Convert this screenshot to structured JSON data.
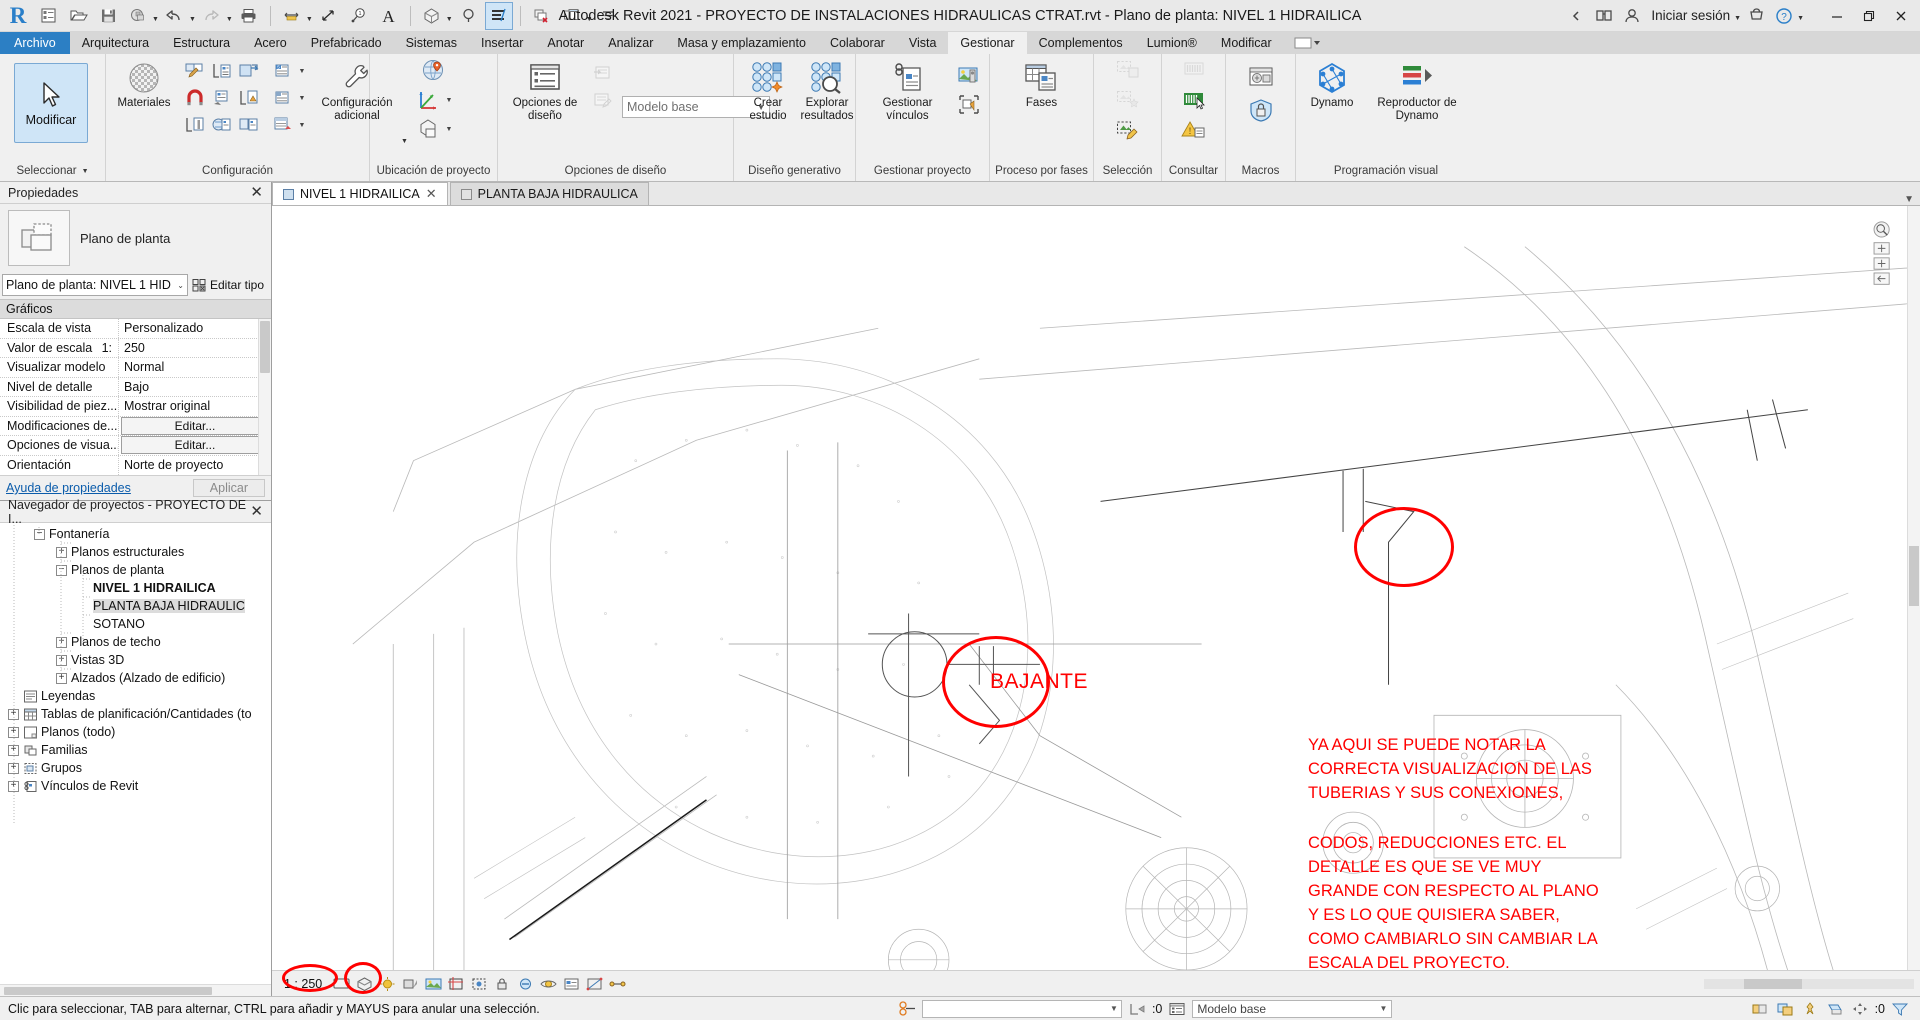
{
  "titlebar": {
    "title": "Autodesk Revit 2021 - PROYECTO DE INSTALACIONES HIDRAULICAS CTRAT.rvt - Plano de planta: NIVEL 1 HIDRAILICA",
    "sign_in": "Iniciar sesión",
    "qat": [
      {
        "name": "revit-logo",
        "label": "R"
      },
      {
        "name": "new-project-icon",
        "label": ""
      },
      {
        "name": "open-icon",
        "label": ""
      },
      {
        "name": "save-icon",
        "label": ""
      },
      {
        "name": "sync-with-central-icon",
        "label": ""
      },
      {
        "name": "undo-icon",
        "label": ""
      },
      {
        "name": "redo-icon",
        "label": ""
      },
      {
        "name": "print-icon",
        "label": ""
      },
      {
        "name": "measure-icon",
        "label": ""
      },
      {
        "name": "aligned-dimension-icon",
        "label": ""
      },
      {
        "name": "tag-icon",
        "label": ""
      },
      {
        "name": "text-icon",
        "label": "A"
      },
      {
        "name": "default-3d-view-icon",
        "label": ""
      },
      {
        "name": "section-icon",
        "label": ""
      },
      {
        "name": "thin-lines-icon",
        "label": ""
      },
      {
        "name": "close-hidden-windows-icon",
        "label": ""
      },
      {
        "name": "switch-windows-icon",
        "label": ""
      },
      {
        "name": "customize-qat-icon",
        "label": ""
      }
    ],
    "window_controls": [
      "minimize",
      "restore",
      "close"
    ]
  },
  "ribbon": {
    "tabs": [
      {
        "label": "Archivo",
        "state": "file"
      },
      {
        "label": "Arquitectura",
        "state": "normal"
      },
      {
        "label": "Estructura",
        "state": "normal"
      },
      {
        "label": "Acero",
        "state": "normal"
      },
      {
        "label": "Prefabricado",
        "state": "normal"
      },
      {
        "label": "Sistemas",
        "state": "normal"
      },
      {
        "label": "Insertar",
        "state": "normal"
      },
      {
        "label": "Anotar",
        "state": "normal"
      },
      {
        "label": "Analizar",
        "state": "normal"
      },
      {
        "label": "Masa y emplazamiento",
        "state": "normal"
      },
      {
        "label": "Colaborar",
        "state": "normal"
      },
      {
        "label": "Vista",
        "state": "normal"
      },
      {
        "label": "Gestionar",
        "state": "active"
      },
      {
        "label": "Complementos",
        "state": "normal"
      },
      {
        "label": "Lumion®",
        "state": "normal"
      },
      {
        "label": "Modificar",
        "state": "normal"
      }
    ],
    "panels": [
      {
        "label": "Seleccionar",
        "has_dropdown": true,
        "buttons": [
          {
            "name": "modify-button",
            "label": "Modificar",
            "selected": true
          }
        ]
      },
      {
        "label": "Configuración",
        "has_dropdown": false,
        "buttons": [
          {
            "name": "materials-button",
            "label": "Materiales"
          },
          {
            "name": "object-styles-button",
            "label": ""
          },
          {
            "name": "snaps-button",
            "label": ""
          },
          {
            "name": "project-information-button",
            "label": ""
          },
          {
            "name": "project-parameters-button",
            "label": ""
          },
          {
            "name": "shared-parameters-button",
            "label": ""
          },
          {
            "name": "transfer-project-standards-button",
            "label": ""
          },
          {
            "name": "purge-unused-button",
            "label": ""
          },
          {
            "name": "project-units-button",
            "label": ""
          },
          {
            "name": "structural-settings-button",
            "label": ""
          },
          {
            "name": "mep-settings-button",
            "label": ""
          },
          {
            "name": "panel-schedule-templates-button",
            "label": ""
          },
          {
            "name": "additional-settings-button",
            "label": "Configuración adicional"
          }
        ]
      },
      {
        "label": "Ubicación de proyecto",
        "has_dropdown": false,
        "buttons": [
          {
            "name": "location-button",
            "label": ""
          },
          {
            "name": "coordinates-button",
            "label": ""
          },
          {
            "name": "position-button",
            "label": ""
          }
        ]
      },
      {
        "label": "Opciones de diseño",
        "has_dropdown": false,
        "buttons": [
          {
            "name": "design-options-button",
            "label": "Opciones de diseño"
          },
          {
            "name": "pick-to-edit-button",
            "label": ""
          },
          {
            "name": "add-to-set-button",
            "label": ""
          }
        ],
        "combo": {
          "name": "design-option-combo",
          "value": "Modelo base"
        }
      },
      {
        "label": "Diseño generativo",
        "has_dropdown": false,
        "buttons": [
          {
            "name": "create-study-button",
            "label": "Crear estudio"
          },
          {
            "name": "explore-results-button",
            "label": "Explorar resultados"
          }
        ]
      },
      {
        "label": "Gestionar proyecto",
        "has_dropdown": false,
        "buttons": [
          {
            "name": "manage-links-button",
            "label": "Gestionar vínculos"
          },
          {
            "name": "manage-images-button",
            "label": ""
          },
          {
            "name": "starting-view-button",
            "label": ""
          }
        ]
      },
      {
        "label": "Proceso por fases",
        "has_dropdown": false,
        "buttons": [
          {
            "name": "phases-button",
            "label": "Fases"
          }
        ]
      },
      {
        "label": "Selección",
        "has_dropdown": false,
        "buttons": [
          {
            "name": "load-selection-button",
            "label": "",
            "disabled": true
          },
          {
            "name": "save-selection-button",
            "label": "",
            "disabled": true
          },
          {
            "name": "edit-selection-button",
            "label": ""
          }
        ]
      },
      {
        "label": "Consultar",
        "has_dropdown": false,
        "buttons": [
          {
            "name": "ids-of-selection-button",
            "label": "",
            "disabled": true
          },
          {
            "name": "select-by-id-button",
            "label": ""
          },
          {
            "name": "warnings-button",
            "label": ""
          }
        ]
      },
      {
        "label": "Macros",
        "has_dropdown": false,
        "buttons": [
          {
            "name": "macro-manager-button",
            "label": ""
          },
          {
            "name": "macro-security-button",
            "label": ""
          }
        ]
      },
      {
        "label": "Programación visual",
        "has_dropdown": false,
        "buttons": [
          {
            "name": "dynamo-button",
            "label": "Dynamo"
          },
          {
            "name": "dynamo-player-button",
            "label": "Reproductor de Dynamo"
          }
        ]
      }
    ]
  },
  "properties": {
    "title": "Propiedades",
    "type_name": "Plano de planta",
    "type_selector": "Plano de planta: NIVEL 1 HID",
    "edit_type": "Editar tipo",
    "group_graficos": "Gráficos",
    "rows": [
      {
        "key": "Escala de vista",
        "sub": "",
        "value": "Personalizado",
        "kind": "text"
      },
      {
        "key": "Valor de escala",
        "sub": "1:",
        "value": "250",
        "kind": "text"
      },
      {
        "key": "Visualizar modelo",
        "sub": "",
        "value": "Normal",
        "kind": "text"
      },
      {
        "key": "Nivel de detalle",
        "sub": "",
        "value": "Bajo",
        "kind": "text"
      },
      {
        "key": "Visibilidad de piez...",
        "sub": "",
        "value": "Mostrar original",
        "kind": "text"
      },
      {
        "key": "Modificaciones de...",
        "sub": "",
        "value": "Editar...",
        "kind": "button"
      },
      {
        "key": "Opciones de visua...",
        "sub": "",
        "value": "Editar...",
        "kind": "button"
      },
      {
        "key": "Orientación",
        "sub": "",
        "value": "Norte de proyecto",
        "kind": "text"
      }
    ],
    "help_link": "Ayuda de propiedades",
    "apply_label": "Aplicar"
  },
  "browser": {
    "title": "Navegador de proyectos - PROYECTO DE I...",
    "nodes": [
      {
        "label": "Fontanería",
        "indent": 2,
        "expander": "minus",
        "bold": false,
        "selected": false,
        "icon": ""
      },
      {
        "label": "Planos estructurales",
        "indent": 3,
        "expander": "plus",
        "bold": false,
        "selected": false,
        "icon": ""
      },
      {
        "label": "Planos de planta",
        "indent": 3,
        "expander": "minus",
        "bold": false,
        "selected": false,
        "icon": ""
      },
      {
        "label": "NIVEL 1 HIDRAILICA",
        "indent": 4,
        "expander": "none",
        "bold": true,
        "selected": false,
        "icon": ""
      },
      {
        "label": "PLANTA BAJA HIDRAULIC",
        "indent": 4,
        "expander": "none",
        "bold": false,
        "selected": true,
        "icon": ""
      },
      {
        "label": "SOTANO",
        "indent": 4,
        "expander": "none",
        "bold": false,
        "selected": false,
        "icon": ""
      },
      {
        "label": "Planos de techo",
        "indent": 3,
        "expander": "plus",
        "bold": false,
        "selected": false,
        "icon": ""
      },
      {
        "label": "Vistas 3D",
        "indent": 3,
        "expander": "plus",
        "bold": false,
        "selected": false,
        "icon": ""
      },
      {
        "label": "Alzados (Alzado de edificio)",
        "indent": 3,
        "expander": "plus",
        "bold": false,
        "selected": false,
        "icon": ""
      },
      {
        "label": "Leyendas",
        "indent": 1,
        "expander": "plus",
        "bold": false,
        "selected": false,
        "icon": "legend"
      },
      {
        "label": "Tablas de planificación/Cantidades (to",
        "indent": 1,
        "expander": "plus",
        "bold": false,
        "selected": false,
        "icon": "schedule"
      },
      {
        "label": "Planos (todo)",
        "indent": 1,
        "expander": "plus",
        "bold": false,
        "selected": false,
        "icon": "sheet"
      },
      {
        "label": "Familias",
        "indent": 1,
        "expander": "plus",
        "bold": false,
        "selected": false,
        "icon": "family"
      },
      {
        "label": "Grupos",
        "indent": 1,
        "expander": "plus",
        "bold": false,
        "selected": false,
        "icon": "group"
      },
      {
        "label": "Vínculos de Revit",
        "indent": 1,
        "expander": "plus",
        "bold": false,
        "selected": false,
        "icon": "link"
      }
    ]
  },
  "view_tabs": [
    {
      "label": "NIVEL 1 HIDRAILICA",
      "active": true,
      "closable": true
    },
    {
      "label": "PLANTA BAJA HIDRAULICA",
      "active": false,
      "closable": false
    }
  ],
  "canvas": {
    "annotations": [
      {
        "name": "bajante-label",
        "text": "BAJANTE"
      },
      {
        "name": "note-paragraph-1",
        "text": "YA AQUI SE PUEDE NOTAR LA\nCORRECTA VISUALIZACION DE LAS\nTUBERIAS Y SUS CONEXIONES,"
      },
      {
        "name": "note-paragraph-2",
        "text": "CODOS, REDUCCIONES ETC.  EL\nDETALLE ES QUE SE VE MUY\nGRANDE CON RESPECTO AL PLANO\nY ES LO QUE QUISIERA SABER,\nCOMO CAMBIARLO SIN CAMBIAR LA\nESCALA DEL PROYECTO."
      }
    ],
    "annotation_color": "#ff0000",
    "highlight_color": "#ff0000"
  },
  "view_control_bar": {
    "scale": "1 : 250",
    "icons": [
      {
        "name": "detail-level-icon"
      },
      {
        "name": "visual-style-icon"
      },
      {
        "name": "sun-path-icon"
      },
      {
        "name": "shadows-icon"
      },
      {
        "name": "render-dialog-icon"
      },
      {
        "name": "crop-view-icon"
      },
      {
        "name": "show-crop-region-icon"
      },
      {
        "name": "lock-3d-view-icon"
      },
      {
        "name": "temporary-hide-isolate-icon"
      },
      {
        "name": "reveal-hidden-elements-icon"
      },
      {
        "name": "temporary-view-properties-icon"
      },
      {
        "name": "analytical-model-icon"
      },
      {
        "name": "constraints-icon"
      }
    ]
  },
  "statusbar": {
    "message": "Clic para seleccionar, TAB para alternar, CTRL para añadir y MAYUS para anular una selección.",
    "filter_count": ":0",
    "design_option": "Modelo base",
    "worksets_icon": "worksets-icon",
    "right_count": ":0",
    "right_icons": [
      {
        "name": "select-links-icon"
      },
      {
        "name": "select-underlay-icon"
      },
      {
        "name": "select-pinned-icon"
      },
      {
        "name": "select-by-face-icon"
      },
      {
        "name": "drag-elements-icon"
      },
      {
        "name": "filter-icon"
      }
    ]
  }
}
